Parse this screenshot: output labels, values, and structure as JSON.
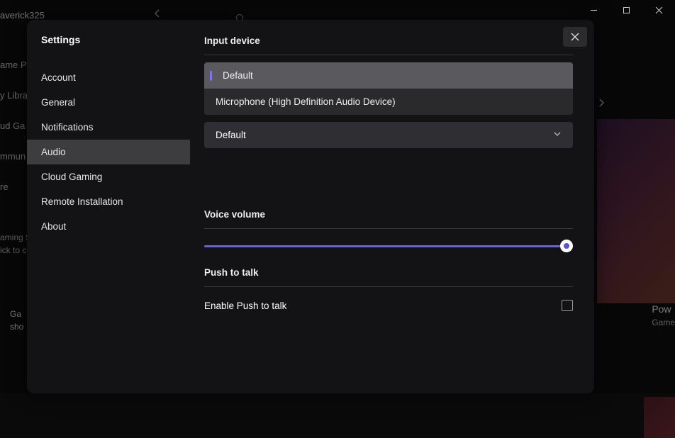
{
  "titlebar": {
    "min": "minimize",
    "max": "maximize",
    "close": "close"
  },
  "bg": {
    "user": "averick325",
    "nav": [
      "ame Pa",
      "y Libra",
      "ud Ga",
      "mmun",
      "re"
    ],
    "status1": "aming S",
    "status2": "ick to c",
    "card1": "Ga",
    "card2": "sho",
    "rtitle": "Pow",
    "rsub": "Game"
  },
  "modal": {
    "title": "Settings",
    "items": [
      "Account",
      "General",
      "Notifications",
      "Audio",
      "Cloud Gaming",
      "Remote Installation",
      "About"
    ],
    "active_index": 3
  },
  "audio": {
    "input_label": "Input device",
    "options": [
      "Default",
      "Microphone (High Definition Audio Device)"
    ],
    "selected_index": 0,
    "dropdown_value": "Default",
    "voice_volume_label": "Voice volume",
    "voice_volume": 100,
    "ptt_label": "Push to talk",
    "ptt_enable_label": "Enable Push to talk",
    "ptt_enabled": false
  }
}
